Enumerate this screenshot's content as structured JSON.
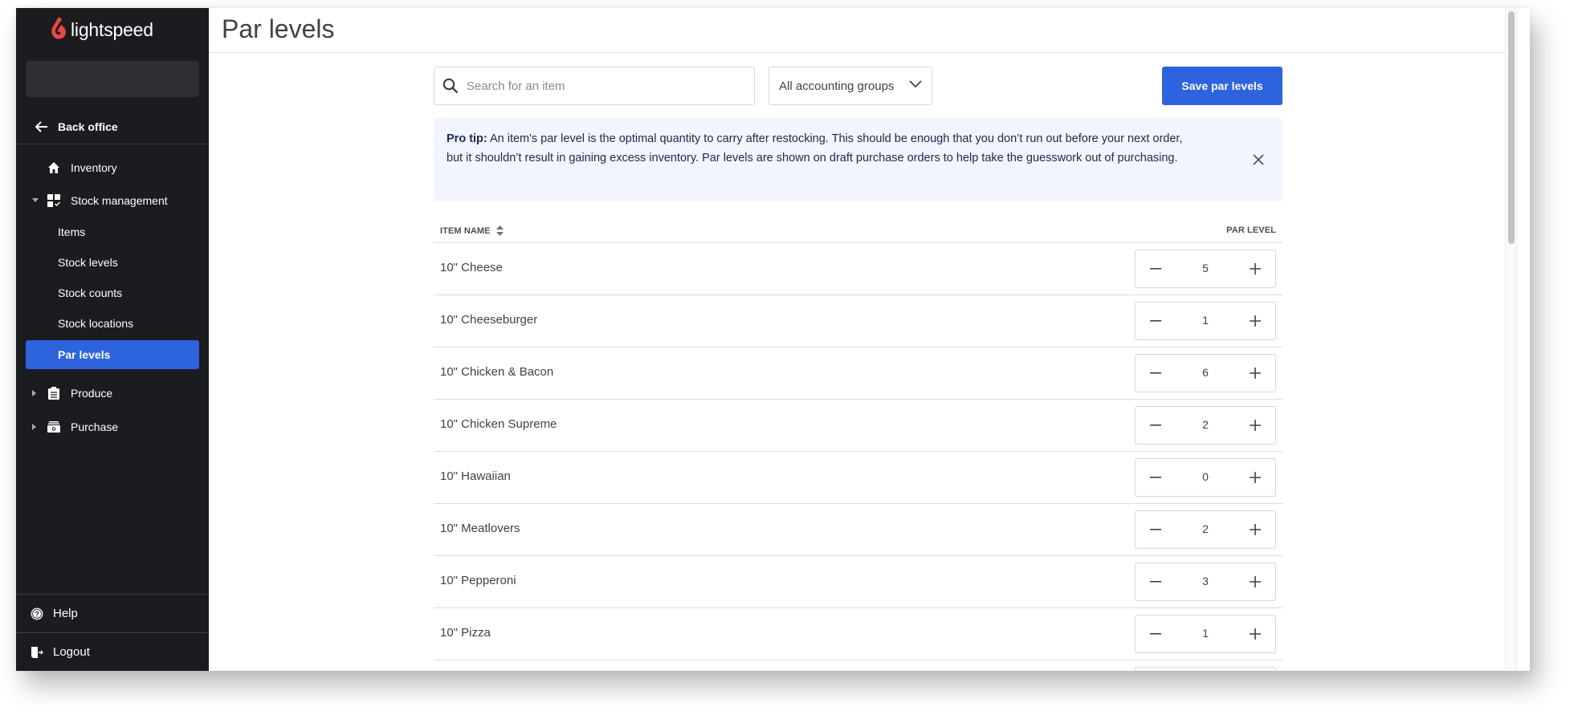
{
  "app": {
    "brand": "lightspeed",
    "brand_color": "#e8483f",
    "accent_color": "#2e63de"
  },
  "sidebar": {
    "search_value": "",
    "back_label": "Back office",
    "items": [
      {
        "label": "Inventory",
        "icon": "home-icon"
      },
      {
        "label": "Stock management",
        "icon": "dashboard-check-icon",
        "expanded": true
      },
      {
        "label": "Produce",
        "icon": "clipboard-icon",
        "expanded": false
      },
      {
        "label": "Purchase",
        "icon": "cash-register-icon",
        "expanded": false
      }
    ],
    "sub_items": [
      {
        "label": "Items"
      },
      {
        "label": "Stock levels"
      },
      {
        "label": "Stock counts"
      },
      {
        "label": "Stock locations"
      },
      {
        "label": "Par levels",
        "active": true
      }
    ],
    "help_label": "Help",
    "logout_label": "Logout"
  },
  "header": {
    "title": "Par levels"
  },
  "toolbar": {
    "search_placeholder": "Search for an item",
    "search_value": "",
    "group_select": "All accounting groups",
    "save_label": "Save par levels"
  },
  "tip": {
    "label": "Pro tip:",
    "text": " An item's par level is the optimal quantity to carry after restocking. This should be enough that you don’t run out before your next order, but it shouldn’t result in gaining excess inventory. Par levels are shown on draft purchase orders to help take the guesswork out of purchasing."
  },
  "table": {
    "columns": [
      "ITEM NAME",
      "PAR LEVEL"
    ],
    "rows": [
      {
        "name": "10\" Cheese",
        "par": "5"
      },
      {
        "name": "10\" Cheeseburger",
        "par": "1"
      },
      {
        "name": "10\" Chicken & Bacon",
        "par": "6"
      },
      {
        "name": "10\" Chicken Supreme",
        "par": "2"
      },
      {
        "name": "10\" Hawaiian",
        "par": "0"
      },
      {
        "name": "10\" Meatlovers",
        "par": "2"
      },
      {
        "name": "10\" Pepperoni",
        "par": "3"
      },
      {
        "name": "10\" Pizza",
        "par": "1"
      },
      {
        "name": "",
        "par": ""
      }
    ]
  }
}
